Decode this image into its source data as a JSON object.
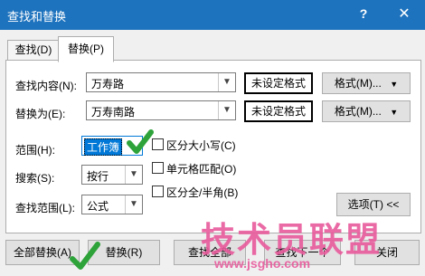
{
  "window": {
    "title": "查找和替换",
    "help": "?",
    "close": "✕"
  },
  "tabs": [
    {
      "label": "查找(D)"
    },
    {
      "label": "替换(P)"
    }
  ],
  "find": {
    "label": "查找内容(N):",
    "value": "万寿路",
    "format_status": "未设定格式",
    "format_button": "格式(M)..."
  },
  "replace": {
    "label": "替换为(E):",
    "value": "万寿南路",
    "format_status": "未设定格式",
    "format_button": "格式(M)..."
  },
  "scope": {
    "label": "范围(H):",
    "value": "工作簿"
  },
  "search": {
    "label": "搜索(S):",
    "value": "按行"
  },
  "lookin": {
    "label": "查找范围(L):",
    "value": "公式"
  },
  "options": {
    "match_case": {
      "label": "区分大小写(C)",
      "checked": false
    },
    "match_cell": {
      "label": "单元格匹配(O)",
      "checked": false
    },
    "match_byte": {
      "label": "区分全/半角(B)",
      "checked": false
    }
  },
  "options_button": "选项(T) <<",
  "buttons": {
    "replace_all": "全部替换(A)",
    "replace": "替换(R)",
    "find_all": "查找全部",
    "find_next": "查找下一个",
    "close": "关闭"
  },
  "watermark": {
    "main": "技术员联盟",
    "sub": "www.jsgho.com"
  },
  "colors": {
    "titlebar": "#1e73be",
    "accent": "#0078d7",
    "watermark": "#e85a9c",
    "checkmark": "#2ea33a"
  }
}
